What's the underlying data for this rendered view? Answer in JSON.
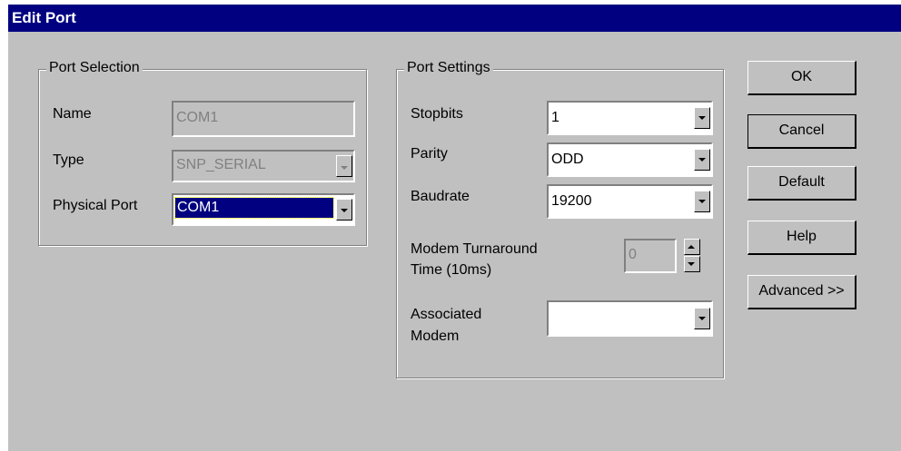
{
  "window": {
    "title": "Edit Port"
  },
  "port_selection": {
    "group_label": "Port Selection",
    "name_label": "Name",
    "name_value": "COM1",
    "type_label": "Type",
    "type_value": "SNP_SERIAL",
    "physical_port_label": "Physical Port",
    "physical_port_value": "COM1"
  },
  "port_settings": {
    "group_label": "Port Settings",
    "stopbits_label": "Stopbits",
    "stopbits_value": "1",
    "parity_label": "Parity",
    "parity_value": "ODD",
    "baudrate_label": "Baudrate",
    "baudrate_value": "19200",
    "modem_turnaround_label_line1": "Modem Turnaround",
    "modem_turnaround_label_line2": "Time (10ms)",
    "modem_turnaround_value": "0",
    "associated_modem_label_line1": "Associated",
    "associated_modem_label_line2": "Modem",
    "associated_modem_value": ""
  },
  "buttons": {
    "ok": "OK",
    "cancel": "Cancel",
    "default": "Default",
    "help": "Help",
    "advanced": "Advanced >>"
  },
  "icons": {
    "dropdown_arrow": "chevron-down-icon",
    "spin_up": "arrow-up-icon",
    "spin_down": "arrow-down-icon"
  }
}
